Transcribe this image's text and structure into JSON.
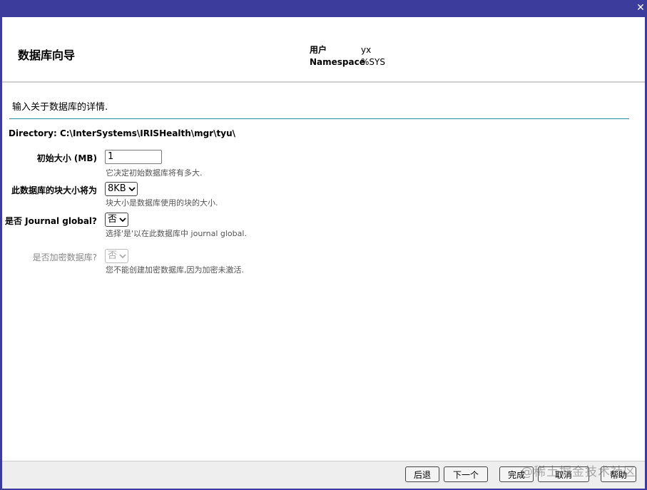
{
  "header": {
    "title": "数据库向导",
    "user_label": "用户",
    "user_value": "yx",
    "namespace_label": "Namespace",
    "namespace_value": "%SYS"
  },
  "content": {
    "intro": "输入关于数据库的详情.",
    "directory_label": "Directory:",
    "directory_value": "C:\\InterSystems\\IRISHealth\\mgr\\tyu\\",
    "fields": {
      "initial_size": {
        "label": "初始大小 (MB)",
        "value": "1",
        "hint": "它决定初始数据库将有多大."
      },
      "block_size": {
        "label": "此数据库的块大小将为",
        "value": "8KB",
        "hint": "块大小是数据库使用的块的大小."
      },
      "journal": {
        "label": "是否 Journal global?",
        "value": "否",
        "hint": "选择'是'以在此数据库中 journal global."
      },
      "encrypt": {
        "label": "是否加密数据库?",
        "value": "否",
        "hint": "您不能创建加密数据库,因为加密未激活."
      }
    }
  },
  "footer": {
    "back_label": "后退",
    "next_label": "下一个",
    "finish_label": "完成",
    "cancel_label": "取消",
    "help_label": "帮助",
    "watermark": "@稀土掘金技术社区"
  },
  "icons": {
    "close": "close-icon",
    "dropdown": "chevron-down-icon"
  },
  "colors": {
    "titlebar": "#3c3c9c",
    "divider": "#2a8f9a"
  }
}
